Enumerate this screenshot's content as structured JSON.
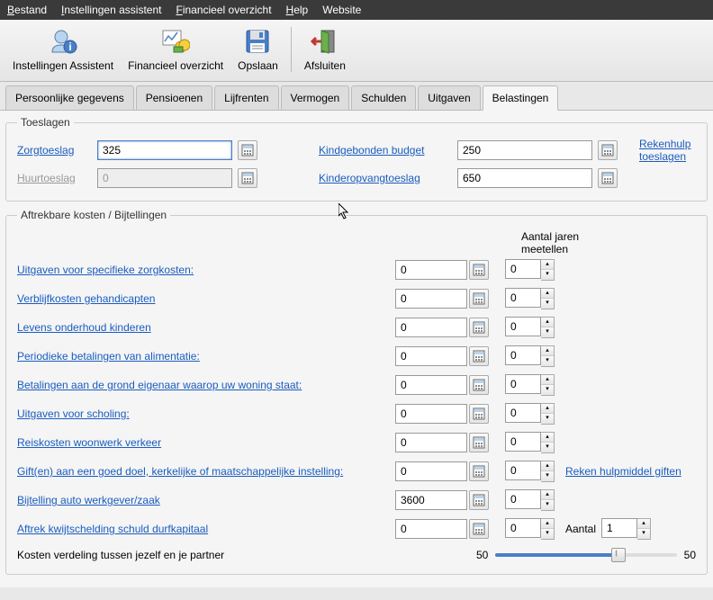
{
  "menubar": {
    "bestand": "Bestand",
    "assistent": "Instellingen assistent",
    "financieel": "Financieel overzicht",
    "help": "Help",
    "website": "Website"
  },
  "toolbar": {
    "assistent": "Instellingen Assistent",
    "financieel": "Financieel overzicht",
    "opslaan": "Opslaan",
    "afsluiten": "Afsluiten"
  },
  "tabs": [
    "Persoonlijke gegevens",
    "Pensioenen",
    "Lijfrenten",
    "Vermogen",
    "Schulden",
    "Uitgaven",
    "Belastingen"
  ],
  "activeTab": 6,
  "toeslagen": {
    "legend": "Toeslagen",
    "zorg_label": "Zorgtoeslag",
    "zorg_val": "325",
    "huur_label": "Huurtoeslag",
    "huur_val": "0",
    "kind_label": "Kindgebonden budget",
    "kind_val": "250",
    "opvang_label": "Kinderopvangtoeslag",
    "opvang_val": "650",
    "rekenhulp": "Rekenhulp toeslagen"
  },
  "aftrek": {
    "legend": "Aftrekbare kosten / Bijtellingen",
    "years_header": "Aantal jaren meetellen",
    "rows": [
      {
        "label": "Uitgaven voor specifieke zorgkosten:",
        "val": "0",
        "years": "0"
      },
      {
        "label": "Verblijfkosten gehandicapten",
        "val": "0",
        "years": "0"
      },
      {
        "label": "Levens onderhoud kinderen",
        "val": "0",
        "years": "0"
      },
      {
        "label": "Periodieke betalingen van alimentatie:",
        "val": "0",
        "years": "0"
      },
      {
        "label": "Betalingen aan de grond eigenaar waarop uw woning staat:",
        "val": "0",
        "years": "0"
      },
      {
        "label": "Uitgaven voor scholing:",
        "val": "0",
        "years": "0"
      },
      {
        "label": "Reiskosten woonwerk verkeer",
        "val": "0",
        "years": "0"
      },
      {
        "label": "Gift(en) aan een goed doel, kerkelijke of maatschappelijke instelling:",
        "val": "0",
        "years": "0"
      },
      {
        "label": "Bijtelling auto werkgever/zaak",
        "val": "3600",
        "years": "0"
      },
      {
        "label": "Aftrek kwijtschelding schuld durfkapitaal",
        "val": "0",
        "years": "0"
      }
    ],
    "giften_link": "Reken hulpmiddel giften",
    "aantal_label": "Aantal",
    "aantal_val": "1",
    "slider_label": "Kosten verdeling tussen jezelf en je partner",
    "slider_left": "50",
    "slider_right": "50"
  }
}
